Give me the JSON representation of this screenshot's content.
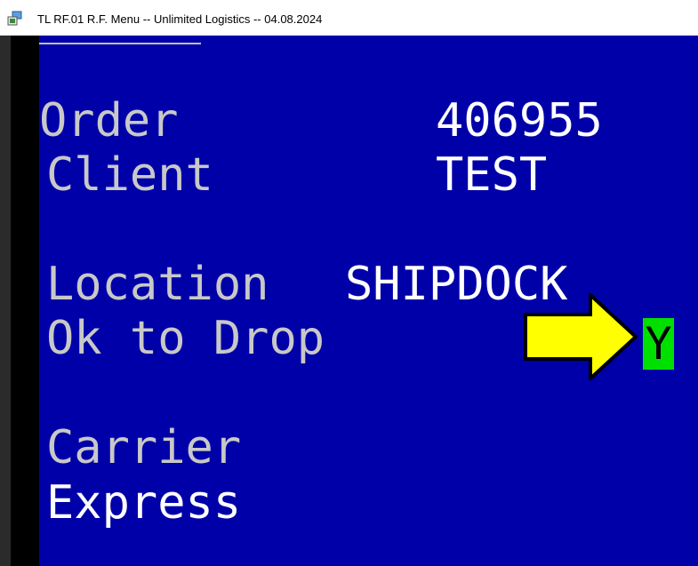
{
  "window": {
    "title": "TL RF.01 R.F. Menu -- Unlimited Logistics -- 04.08.2024",
    "icon": "app-window-icon"
  },
  "screen": {
    "order_label": "Order",
    "order_value": "406955",
    "client_label": "Client",
    "client_value": "TEST",
    "location_label": "Location",
    "location_value": "SHIPDOCK",
    "drop_label": "Ok to Drop",
    "drop_value": "Y",
    "carrier_label": "Carrier",
    "carrier_value": "Express"
  },
  "annotation": {
    "icon": "yellow-arrow-icon",
    "color": "#ffff00"
  },
  "colors": {
    "background": "#0000a8",
    "label": "#c8c8c8",
    "value": "#ffffff",
    "input_highlight": "#00e000"
  }
}
